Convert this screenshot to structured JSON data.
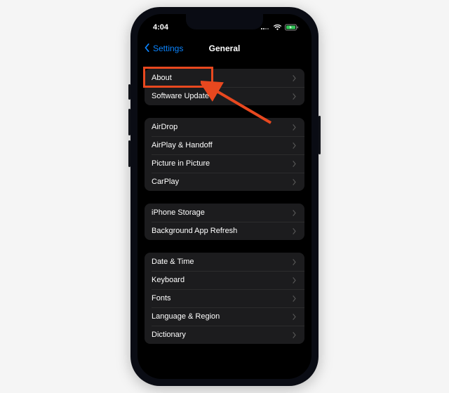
{
  "status": {
    "time": "4:04",
    "wifi_icon": "wifi-icon",
    "battery_icon": "battery-charging-icon"
  },
  "nav": {
    "back_label": "Settings",
    "title": "General"
  },
  "groups": [
    {
      "rows": [
        {
          "label": "About"
        },
        {
          "label": "Software Update"
        }
      ]
    },
    {
      "rows": [
        {
          "label": "AirDrop"
        },
        {
          "label": "AirPlay & Handoff"
        },
        {
          "label": "Picture in Picture"
        },
        {
          "label": "CarPlay"
        }
      ]
    },
    {
      "rows": [
        {
          "label": "iPhone Storage"
        },
        {
          "label": "Background App Refresh"
        }
      ]
    },
    {
      "rows": [
        {
          "label": "Date & Time"
        },
        {
          "label": "Keyboard"
        },
        {
          "label": "Fonts"
        },
        {
          "label": "Language & Region"
        },
        {
          "label": "Dictionary"
        }
      ]
    }
  ],
  "annotation": {
    "highlight_target": "About",
    "highlight_color": "#e8481f",
    "arrow_color": "#e8481f"
  }
}
